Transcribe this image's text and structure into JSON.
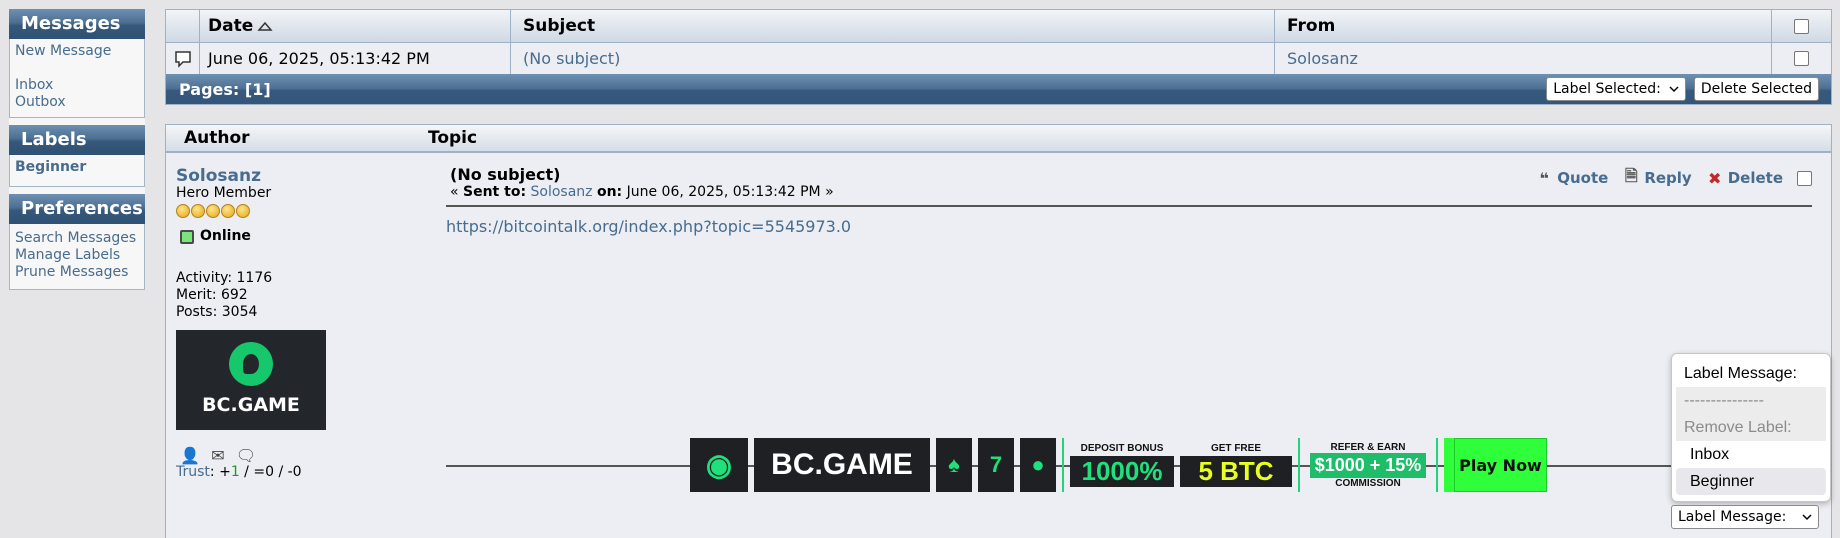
{
  "sidebar": {
    "messages": {
      "title": "Messages",
      "items": [
        "New Message",
        "Inbox",
        "Outbox"
      ]
    },
    "labels": {
      "title": "Labels",
      "items": [
        "Beginner"
      ]
    },
    "preferences": {
      "title": "Preferences",
      "items": [
        "Search Messages",
        "Manage Labels",
        "Prune Messages"
      ]
    }
  },
  "list": {
    "headers": {
      "date": "Date",
      "subject": "Subject",
      "from": "From"
    },
    "rows": [
      {
        "date": "June 06, 2025, 05:13:42 PM",
        "subject": "(No subject)",
        "from": "Solosanz"
      }
    ],
    "pages_text": "Pages: [1]",
    "label_selected": "Label Selected:",
    "delete_selected": "Delete Selected"
  },
  "post": {
    "headers": {
      "author": "Author",
      "topic": "Topic"
    },
    "author": {
      "name": "Solosanz",
      "rank": "Hero Member",
      "stars": 5,
      "status": "Online",
      "activity": "Activity: 1176",
      "merit": "Merit: 692",
      "posts": "Posts: 3054",
      "avatar_text": "BC.GAME",
      "trust_label": "Trust",
      "trust_colon": ": +",
      "trust_pos": "1",
      "trust_rest": " / =0 / -0"
    },
    "title": "(No subject)",
    "sent_prefix": "« ",
    "sent_to_label": "Sent to:",
    "sent_to_name": "Solosanz",
    "on_label": "on:",
    "sent_date": "June 06, 2025, 05:13:42 PM »",
    "actions": {
      "quote": "Quote",
      "reply": "Reply",
      "delete": "Delete"
    },
    "body_link": "https://bitcointalk.org/index.php?topic=5545973.0"
  },
  "banner": {
    "brand": "BC.GAME",
    "deposit_label": "DEPOSIT BONUS",
    "deposit_value": "1000%",
    "free_label": "GET FREE",
    "free_value": "5 BTC",
    "refer_label": "REFER & EARN",
    "refer_value": "$1000 + 15%",
    "commission_label": "COMMISSION",
    "play": "Play Now"
  },
  "label_dropdown": {
    "header": "Label Message:",
    "separator": "---------------",
    "remove": "Remove Label:",
    "options": [
      "Inbox",
      "Beginner"
    ],
    "selected": "Label Message:"
  },
  "colors": {
    "link": "#476c8e",
    "header_blue": "#4d6f92",
    "online_green": "#7ae37a",
    "banner_green": "#1fe07b"
  }
}
